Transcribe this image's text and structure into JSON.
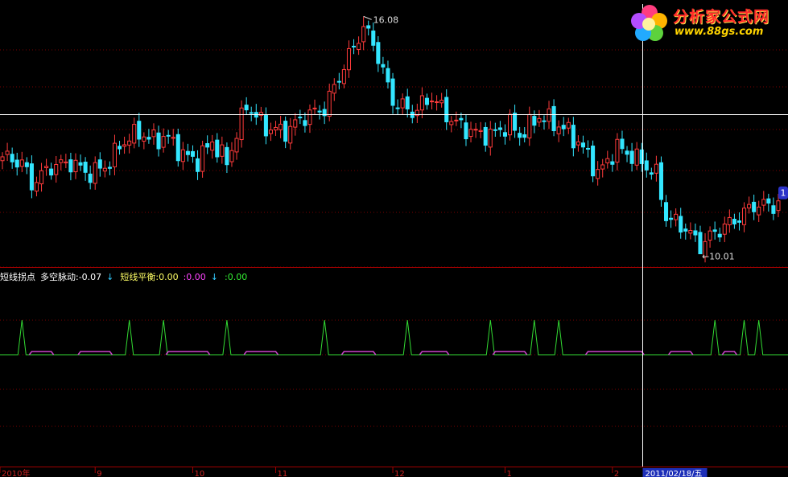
{
  "logo": {
    "title": "分析家公式网",
    "url": "www.88gs.com"
  },
  "price_panel": {
    "high_label": "16.08",
    "low_label": "10.01",
    "right_badge": "1"
  },
  "indicator_panel": {
    "legend": [
      {
        "text": "短线拐点",
        "color": "#ffffff"
      },
      {
        "text": "多空脉动:-0.07",
        "color": "#ffffff"
      },
      {
        "text": "↓",
        "color": "#33ccff"
      },
      {
        "text": "短线平衡:0.00",
        "color": "#ffff66"
      },
      {
        "text": ":0.00",
        "color": "#ff44ff"
      },
      {
        "text": "↓",
        "color": "#33ccff"
      },
      {
        "text": ":0.00",
        "color": "#33ee33"
      }
    ]
  },
  "time_axis": {
    "labels": [
      "2010年",
      "9",
      "10",
      "11",
      "12",
      "1",
      "2"
    ],
    "cursor_label": "2011/02/18/五"
  },
  "colors": {
    "up": "#ff3b3b",
    "down": "#33e6ff",
    "grid": "#7a0000",
    "crosshair": "#ffffff",
    "signal": "#33dd33",
    "balance": "#cc44cc"
  },
  "chart_data": [
    {
      "type": "candlestick",
      "title": "",
      "ylim": [
        9.6,
        16.4
      ],
      "x_count": 160,
      "extremes": {
        "high": 16.08,
        "low": 10.01
      },
      "anchors": [
        [
          0,
          12.45
        ],
        [
          4,
          12.3
        ],
        [
          6,
          11.75
        ],
        [
          10,
          12.2
        ],
        [
          14,
          12.3
        ],
        [
          18,
          12.0
        ],
        [
          22,
          12.3
        ],
        [
          24,
          12.75
        ],
        [
          28,
          13.1
        ],
        [
          30,
          12.9
        ],
        [
          34,
          12.95
        ],
        [
          37,
          12.5
        ],
        [
          40,
          12.35
        ],
        [
          43,
          12.85
        ],
        [
          46,
          12.3
        ],
        [
          50,
          13.8
        ],
        [
          54,
          13.2
        ],
        [
          58,
          13.1
        ],
        [
          62,
          13.5
        ],
        [
          66,
          13.7
        ],
        [
          70,
          14.8
        ],
        [
          74,
          15.8
        ],
        [
          76,
          15.4
        ],
        [
          80,
          13.9
        ],
        [
          84,
          13.6
        ],
        [
          88,
          14.0
        ],
        [
          92,
          13.4
        ],
        [
          96,
          13.1
        ],
        [
          100,
          13.0
        ],
        [
          104,
          13.3
        ],
        [
          106,
          13.0
        ],
        [
          110,
          13.5
        ],
        [
          112,
          13.4
        ],
        [
          116,
          13.1
        ],
        [
          120,
          12.5
        ],
        [
          122,
          12.0
        ],
        [
          126,
          12.7
        ],
        [
          130,
          12.4
        ],
        [
          134,
          12.0
        ],
        [
          136,
          10.9
        ],
        [
          140,
          10.6
        ],
        [
          143,
          10.15
        ],
        [
          146,
          10.5
        ],
        [
          150,
          10.8
        ],
        [
          154,
          11.2
        ],
        [
          158,
          11.2
        ],
        [
          160,
          11.3
        ]
      ],
      "indicator": {
        "signal_peaks": [
          4,
          26,
          33,
          46,
          66,
          83,
          100,
          109,
          114,
          146,
          152,
          155
        ],
        "balance_segments": [
          [
            6,
            10
          ],
          [
            16,
            22
          ],
          [
            34,
            42
          ],
          [
            50,
            56
          ],
          [
            70,
            76
          ],
          [
            86,
            91
          ],
          [
            101,
            107
          ],
          [
            120,
            131
          ],
          [
            137,
            141
          ],
          [
            148,
            150
          ]
        ]
      }
    }
  ]
}
